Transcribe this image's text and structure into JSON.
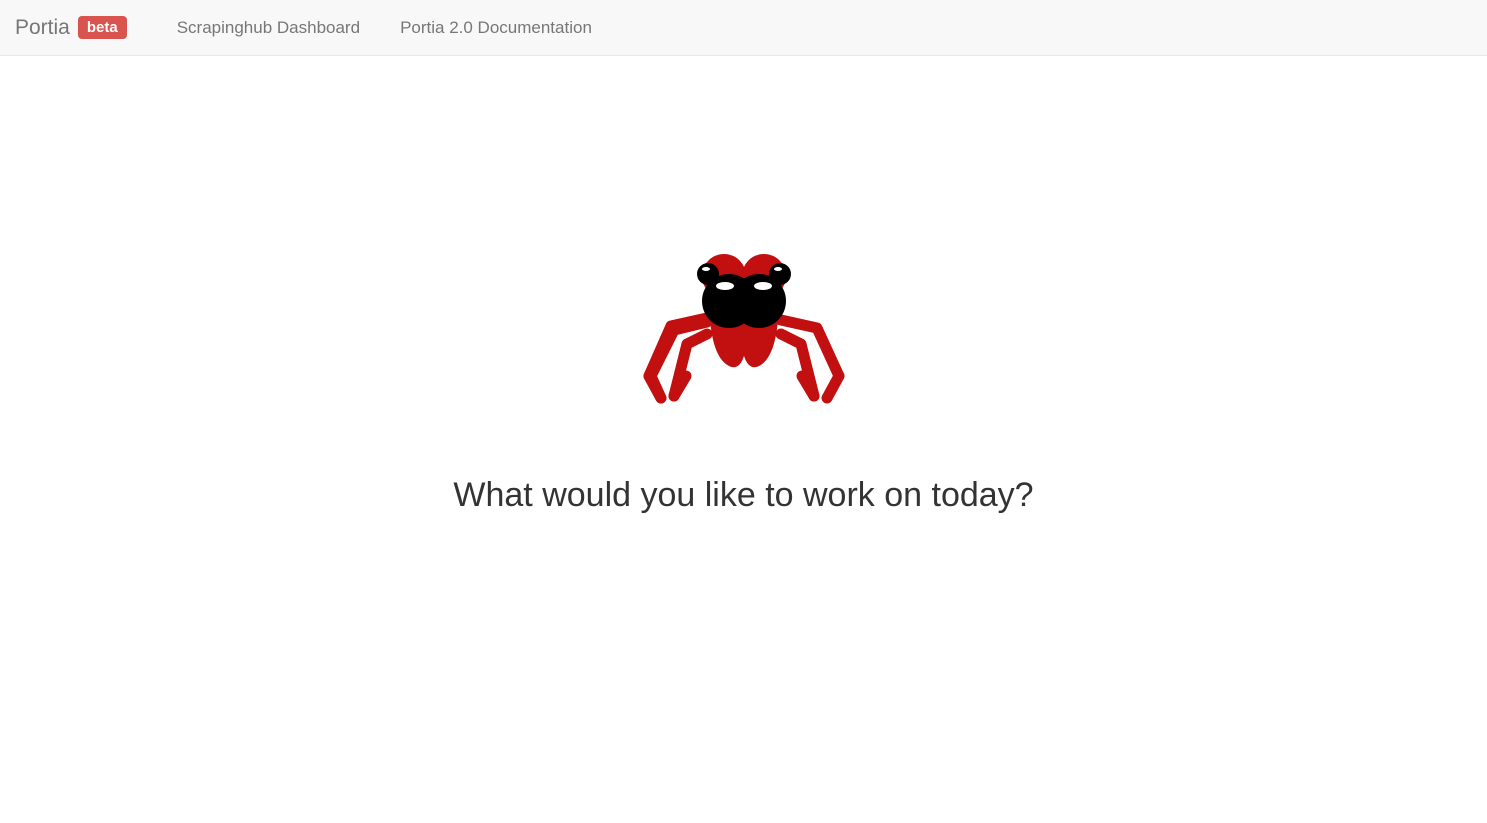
{
  "navbar": {
    "brand_text": "Portia",
    "badge_text": "beta",
    "links": [
      {
        "label": "Scrapinghub Dashboard"
      },
      {
        "label": "Portia 2.0 Documentation"
      }
    ]
  },
  "main": {
    "headline": "What would you like to work on today?",
    "icon_name": "spider-logo"
  },
  "colors": {
    "accent_red": "#d9534f",
    "spider_red": "#c20f0f",
    "nav_bg": "#f8f8f8",
    "text_muted": "#777",
    "headline_color": "#333"
  }
}
